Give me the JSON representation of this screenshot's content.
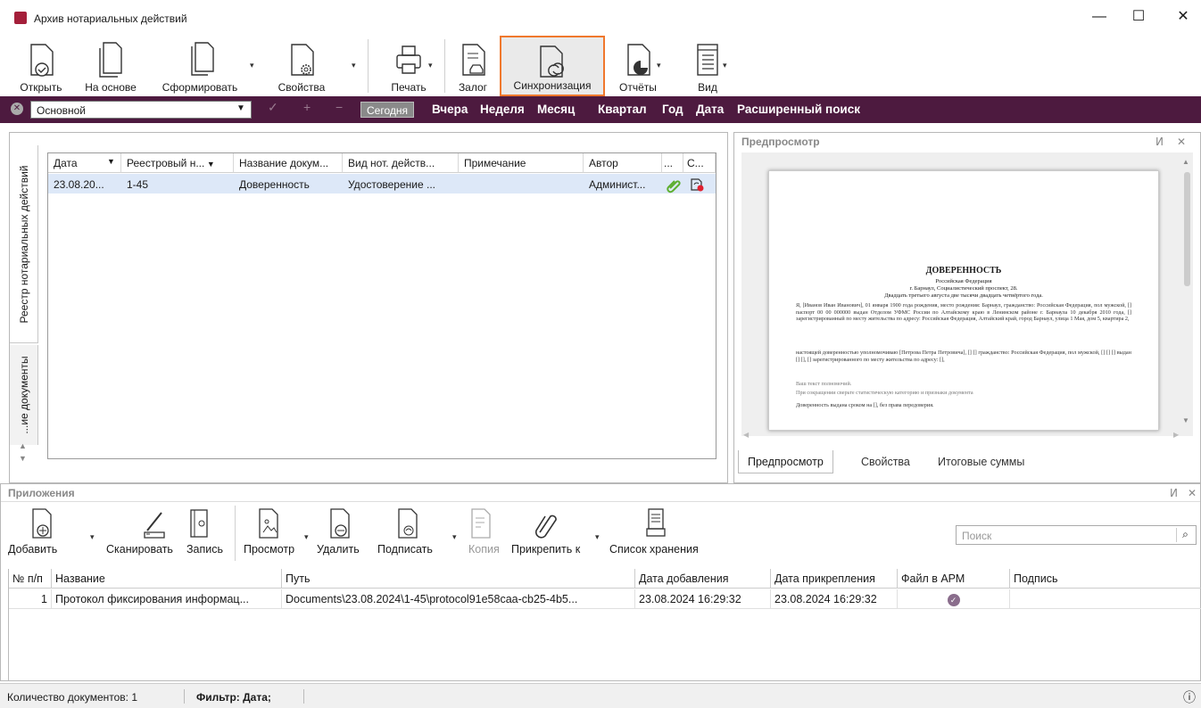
{
  "window": {
    "title": "Архив нотариальных действий",
    "min": "—",
    "max": "☐",
    "close": "✕"
  },
  "ribbon": {
    "open": "Открыть",
    "based_on": "На основе",
    "form": "Сформировать",
    "properties": "Свойства",
    "print": "Печать",
    "pledge": "Залог",
    "sync": "Синхронизация",
    "reports": "Отчёты",
    "view": "Вид"
  },
  "filter": {
    "combo_value": "Основной",
    "today": "Сегодня",
    "yesterday": "Вчера",
    "week": "Неделя",
    "month": "Месяц",
    "quarter": "Квартал",
    "year": "Год",
    "date": "Дата",
    "advanced": "Расширенный поиск"
  },
  "left": {
    "tab_registry": "Реестр нотариальных действий",
    "tab_docs": "...ие документы",
    "columns": [
      "Дата",
      "Реестровый н...",
      "Название докум...",
      "Вид нот. действ...",
      "Примечание",
      "Автор",
      "...",
      "С..."
    ],
    "rows": [
      [
        "23.08.20...",
        "1-45",
        "Доверенность",
        "Удостоверение ...",
        "",
        "Админист..."
      ]
    ]
  },
  "preview": {
    "title": "Предпросмотр",
    "pin": "ⵍ",
    "close": "✕",
    "doc": {
      "heading": "ДОВЕРЕННОСТЬ",
      "l1": "Российская Федерация",
      "l2": "г. Барнаул, Социалистический проспект, 28.",
      "l3": "Двадцать третьего августа две тысячи двадцать четвёртого года.",
      "p1": "Я, [Иванов Иван Иванович], 01 января 1900 года рождения, место рождения: Барнаул, гражданство: Российская Федерация, пол мужской, [] паспорт 00 00 000000 выдан Отделом УФМС России по Алтайскому краю в Ленинском районе г. Барнаула 10 декабря 2010 года, [] зарегистрированный по месту жительства по адресу: Российская Федерация, Алтайский край, город Барнаул, улица 1 Мая, дом 5, квартира 2,",
      "p2": "настоящей доверенностью уполномочиваю [Петрова Петра Петровича], [] [] гражданство: Российская Федерация, пол мужской, [] [] [] выдан [] [], [] зарегистрированного по месту жительства по адресу: [],",
      "p3": "Ваш текст полномочий.",
      "p4": "При сокращении сверьте статистическую категорию и признаки документа",
      "p5": "Доверенность выдана сроком на [], без права передоверия."
    },
    "tabs": [
      "Предпросмотр",
      "Свойства",
      "Итоговые суммы"
    ]
  },
  "attachments": {
    "title": "Приложения",
    "add": "Добавить",
    "scan": "Сканировать",
    "record": "Запись",
    "view": "Просмотр",
    "delete": "Удалить",
    "sign": "Подписать",
    "copy": "Копия",
    "attach_to": "Прикрепить к",
    "storage_list": "Список хранения",
    "search_placeholder": "Поиск",
    "columns": [
      "№ п/п",
      "Название",
      "Путь",
      "Дата добавления",
      "Дата прикрепления",
      "Файл в АРМ",
      "Подпись"
    ],
    "rows": [
      [
        "1",
        "Протокол фиксирования информац...",
        "Documents\\23.08.2024\\1-45\\protocol91e58caa-cb25-4b5...",
        "23.08.2024 16:29:32",
        "23.08.2024 16:29:32"
      ]
    ]
  },
  "status": {
    "count": "Количество документов: 1",
    "filter": "Фильтр: Дата;",
    "info": "ⓘ"
  },
  "colors": {
    "accent": "#4d1a3f",
    "active_border": "#f0782d",
    "selection": "#dde8f8"
  }
}
